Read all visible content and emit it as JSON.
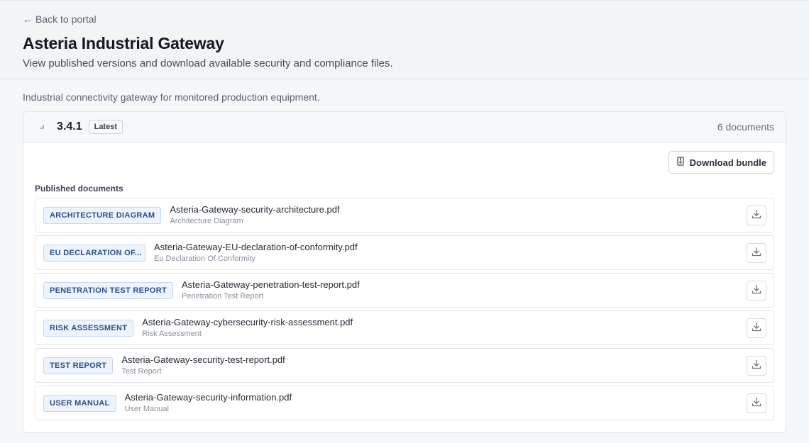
{
  "header": {
    "back_label": "Back to portal",
    "title": "Asteria Industrial Gateway",
    "subtitle": "View published versions and download available security and compliance files."
  },
  "product": {
    "description": "Industrial connectivity gateway for monitored production equipment."
  },
  "version": {
    "number": "3.4.1",
    "badge": "Latest",
    "doc_count": "6 documents",
    "bundle_label": "Download bundle",
    "section_label": "Published documents",
    "documents": [
      {
        "tag": "ARCHITECTURE DIAGRAM",
        "file": "Asteria-Gateway-security-architecture.pdf",
        "type": "Architecture Diagram"
      },
      {
        "tag": "EU DECLARATION OF...",
        "file": "Asteria-Gateway-EU-declaration-of-conformity.pdf",
        "type": "Eu Declaration Of Conformity"
      },
      {
        "tag": "PENETRATION TEST REPORT",
        "file": "Asteria-Gateway-penetration-test-report.pdf",
        "type": "Penetration Test Report"
      },
      {
        "tag": "RISK ASSESSMENT",
        "file": "Asteria-Gateway-cybersecurity-risk-assessment.pdf",
        "type": "Risk Assessment"
      },
      {
        "tag": "TEST REPORT",
        "file": "Asteria-Gateway-security-test-report.pdf",
        "type": "Test Report"
      },
      {
        "tag": "USER MANUAL",
        "file": "Asteria-Gateway-security-information.pdf",
        "type": "User Manual"
      }
    ]
  },
  "icons": {
    "back": "arrow-left-icon",
    "collapse": "chevron-icon",
    "bundle": "archive-icon",
    "download": "download-icon"
  },
  "colors": {
    "tag_bg": "#eef4fd",
    "tag_border": "#c7d7ef",
    "tag_text": "#2b4f8d",
    "title": "#141823"
  }
}
